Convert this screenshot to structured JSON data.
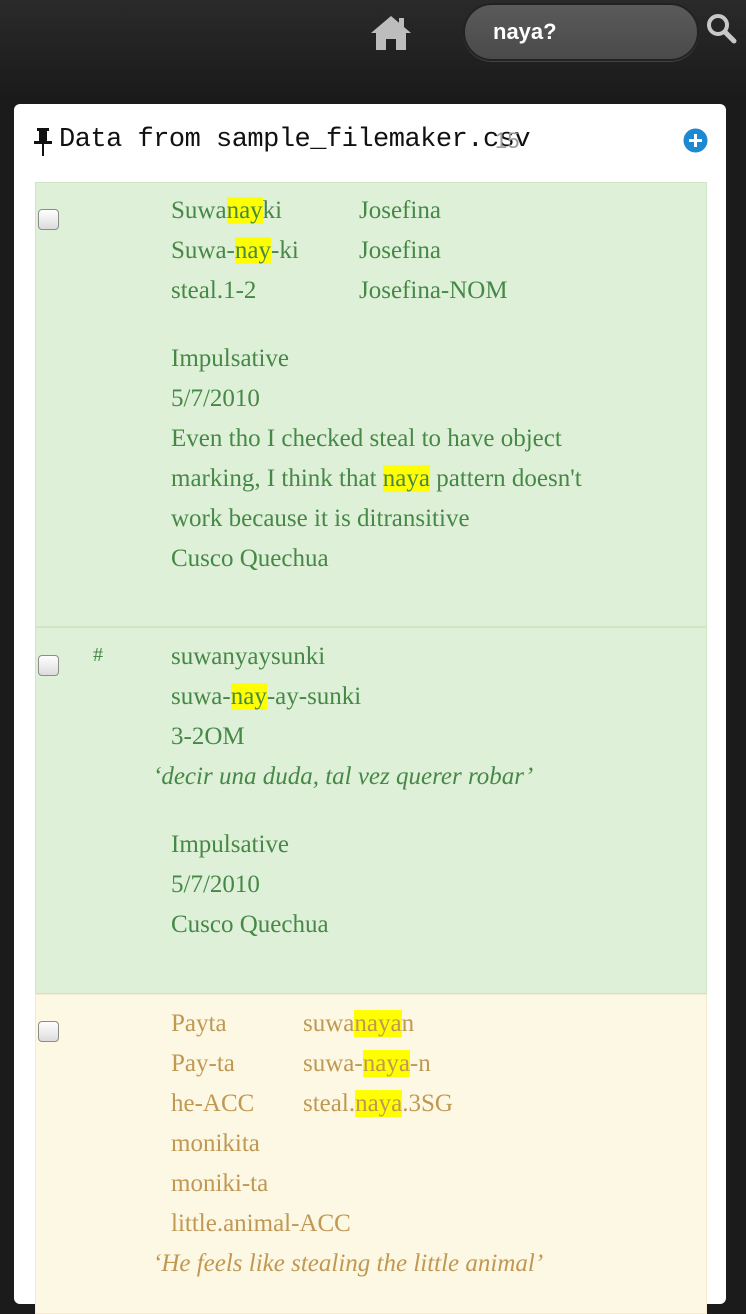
{
  "search": {
    "value": "naya?"
  },
  "panel": {
    "title": "Data from sample_filemaker.csv",
    "count": "15"
  },
  "entry1": {
    "w1_a": "Suwa",
    "w1_b": "nay",
    "w1_c": "ki",
    "w1m_a": "Suwa-",
    "w1m_b": "nay",
    "w1m_c": "-ki",
    "w1_gloss": "steal.1-2",
    "w2": "Josefina",
    "w2_morph": "Josefina",
    "w2_gloss": "Josefina-NOM",
    "tag": "Impulsative",
    "date": "5/7/2010",
    "note1": "Even tho I checked steal to have object",
    "note2_a": "marking, I think that ",
    "note2_b": "naya",
    "note2_c": " pattern doesn't",
    "note3": "work because it is ditransitive",
    "language": "Cusco Quechua"
  },
  "entry2": {
    "marker": "#",
    "w1": "suwanyaysunki",
    "w1m_a": "suwa-",
    "w1m_b": "nay",
    "w1m_c": "-ay-sunki",
    "w1_gloss": "3-2OM",
    "translation": "‘decir una duda, tal vez querer robar’",
    "tag": "Impulsative",
    "date": "5/7/2010",
    "language": "Cusco Quechua"
  },
  "entry3": {
    "w1": "Payta",
    "w1_morph": "Pay-ta",
    "w1_gloss": "he-ACC",
    "w2_a": "suwa",
    "w2_b": "naya",
    "w2_c": "n",
    "w2m_a": "suwa-",
    "w2m_b": "naya",
    "w2m_c": "-n",
    "w2g_a": "steal.",
    "w2g_b": "naya",
    "w2g_c": ".3SG",
    "w3": "monikita",
    "w3_morph": "moniki-ta",
    "w3_gloss": "little.animal-ACC",
    "translation": "‘He feels like stealing the little animal’"
  }
}
